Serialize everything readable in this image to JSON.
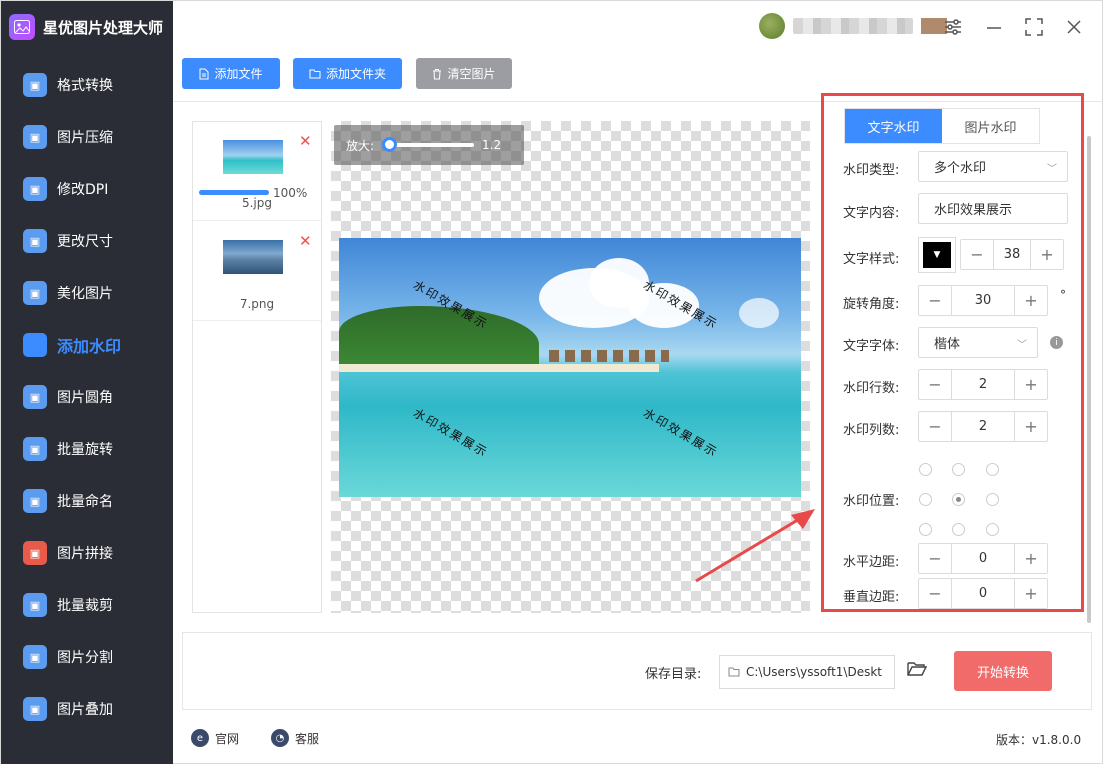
{
  "app": {
    "title": "星优图片处理大师"
  },
  "sidebar": {
    "items": [
      {
        "label": "格式转换",
        "icon": "format-convert-icon",
        "color": "#5b9cf0"
      },
      {
        "label": "图片压缩",
        "icon": "compress-icon",
        "color": "#5b9cf0"
      },
      {
        "label": "修改DPI",
        "icon": "dpi-icon",
        "color": "#5b9cf0"
      },
      {
        "label": "更改尺寸",
        "icon": "resize-icon",
        "color": "#5b9cf0"
      },
      {
        "label": "美化图片",
        "icon": "beautify-icon",
        "color": "#5b9cf0"
      },
      {
        "label": "添加水印",
        "icon": "watermark-icon",
        "color": "#3c8bff",
        "active": true
      },
      {
        "label": "图片圆角",
        "icon": "round-corner-icon",
        "color": "#5b9cf0"
      },
      {
        "label": "批量旋转",
        "icon": "rotate-icon",
        "color": "#5b9cf0"
      },
      {
        "label": "批量命名",
        "icon": "rename-icon",
        "color": "#5b9cf0"
      },
      {
        "label": "图片拼接",
        "icon": "stitch-icon",
        "color": "#e85b4a"
      },
      {
        "label": "批量裁剪",
        "icon": "crop-icon",
        "color": "#5b9cf0"
      },
      {
        "label": "图片分割",
        "icon": "split-icon",
        "color": "#5b9cf0"
      },
      {
        "label": "图片叠加",
        "icon": "overlay-icon",
        "color": "#5b9cf0"
      }
    ]
  },
  "toolbar": {
    "add_file": "添加文件",
    "add_folder": "添加文件夹",
    "clear": "清空图片"
  },
  "files": [
    {
      "name": "5.jpg",
      "progress": "100%"
    },
    {
      "name": "7.png"
    }
  ],
  "preview": {
    "zoom_label": "放大:",
    "zoom_value": "1.2",
    "watermark_text": "水印效果展示"
  },
  "settings": {
    "tabs": [
      "文字水印",
      "图片水印"
    ],
    "type_label": "水印类型:",
    "type_value": "多个水印",
    "content_label": "文字内容:",
    "content_value": "水印效果展示",
    "style_label": "文字样式:",
    "font_size": "38",
    "rotate_label": "旋转角度:",
    "rotate_value": "30",
    "rotate_unit": "°",
    "font_label": "文字字体:",
    "font_value": "楷体",
    "rows_label": "水印行数:",
    "rows_value": "2",
    "cols_label": "水印列数:",
    "cols_value": "2",
    "position_label": "水印位置:",
    "hmargin_label": "水平边距:",
    "hmargin_value": "0",
    "vmargin_label": "垂直边距:",
    "vmargin_value": "0"
  },
  "save": {
    "label": "保存目录:",
    "path": "C:\\Users\\yssoft1\\Deskt",
    "start": "开始转换"
  },
  "footer": {
    "site": "官网",
    "service": "客服",
    "version": "版本：v1.8.0.0"
  }
}
